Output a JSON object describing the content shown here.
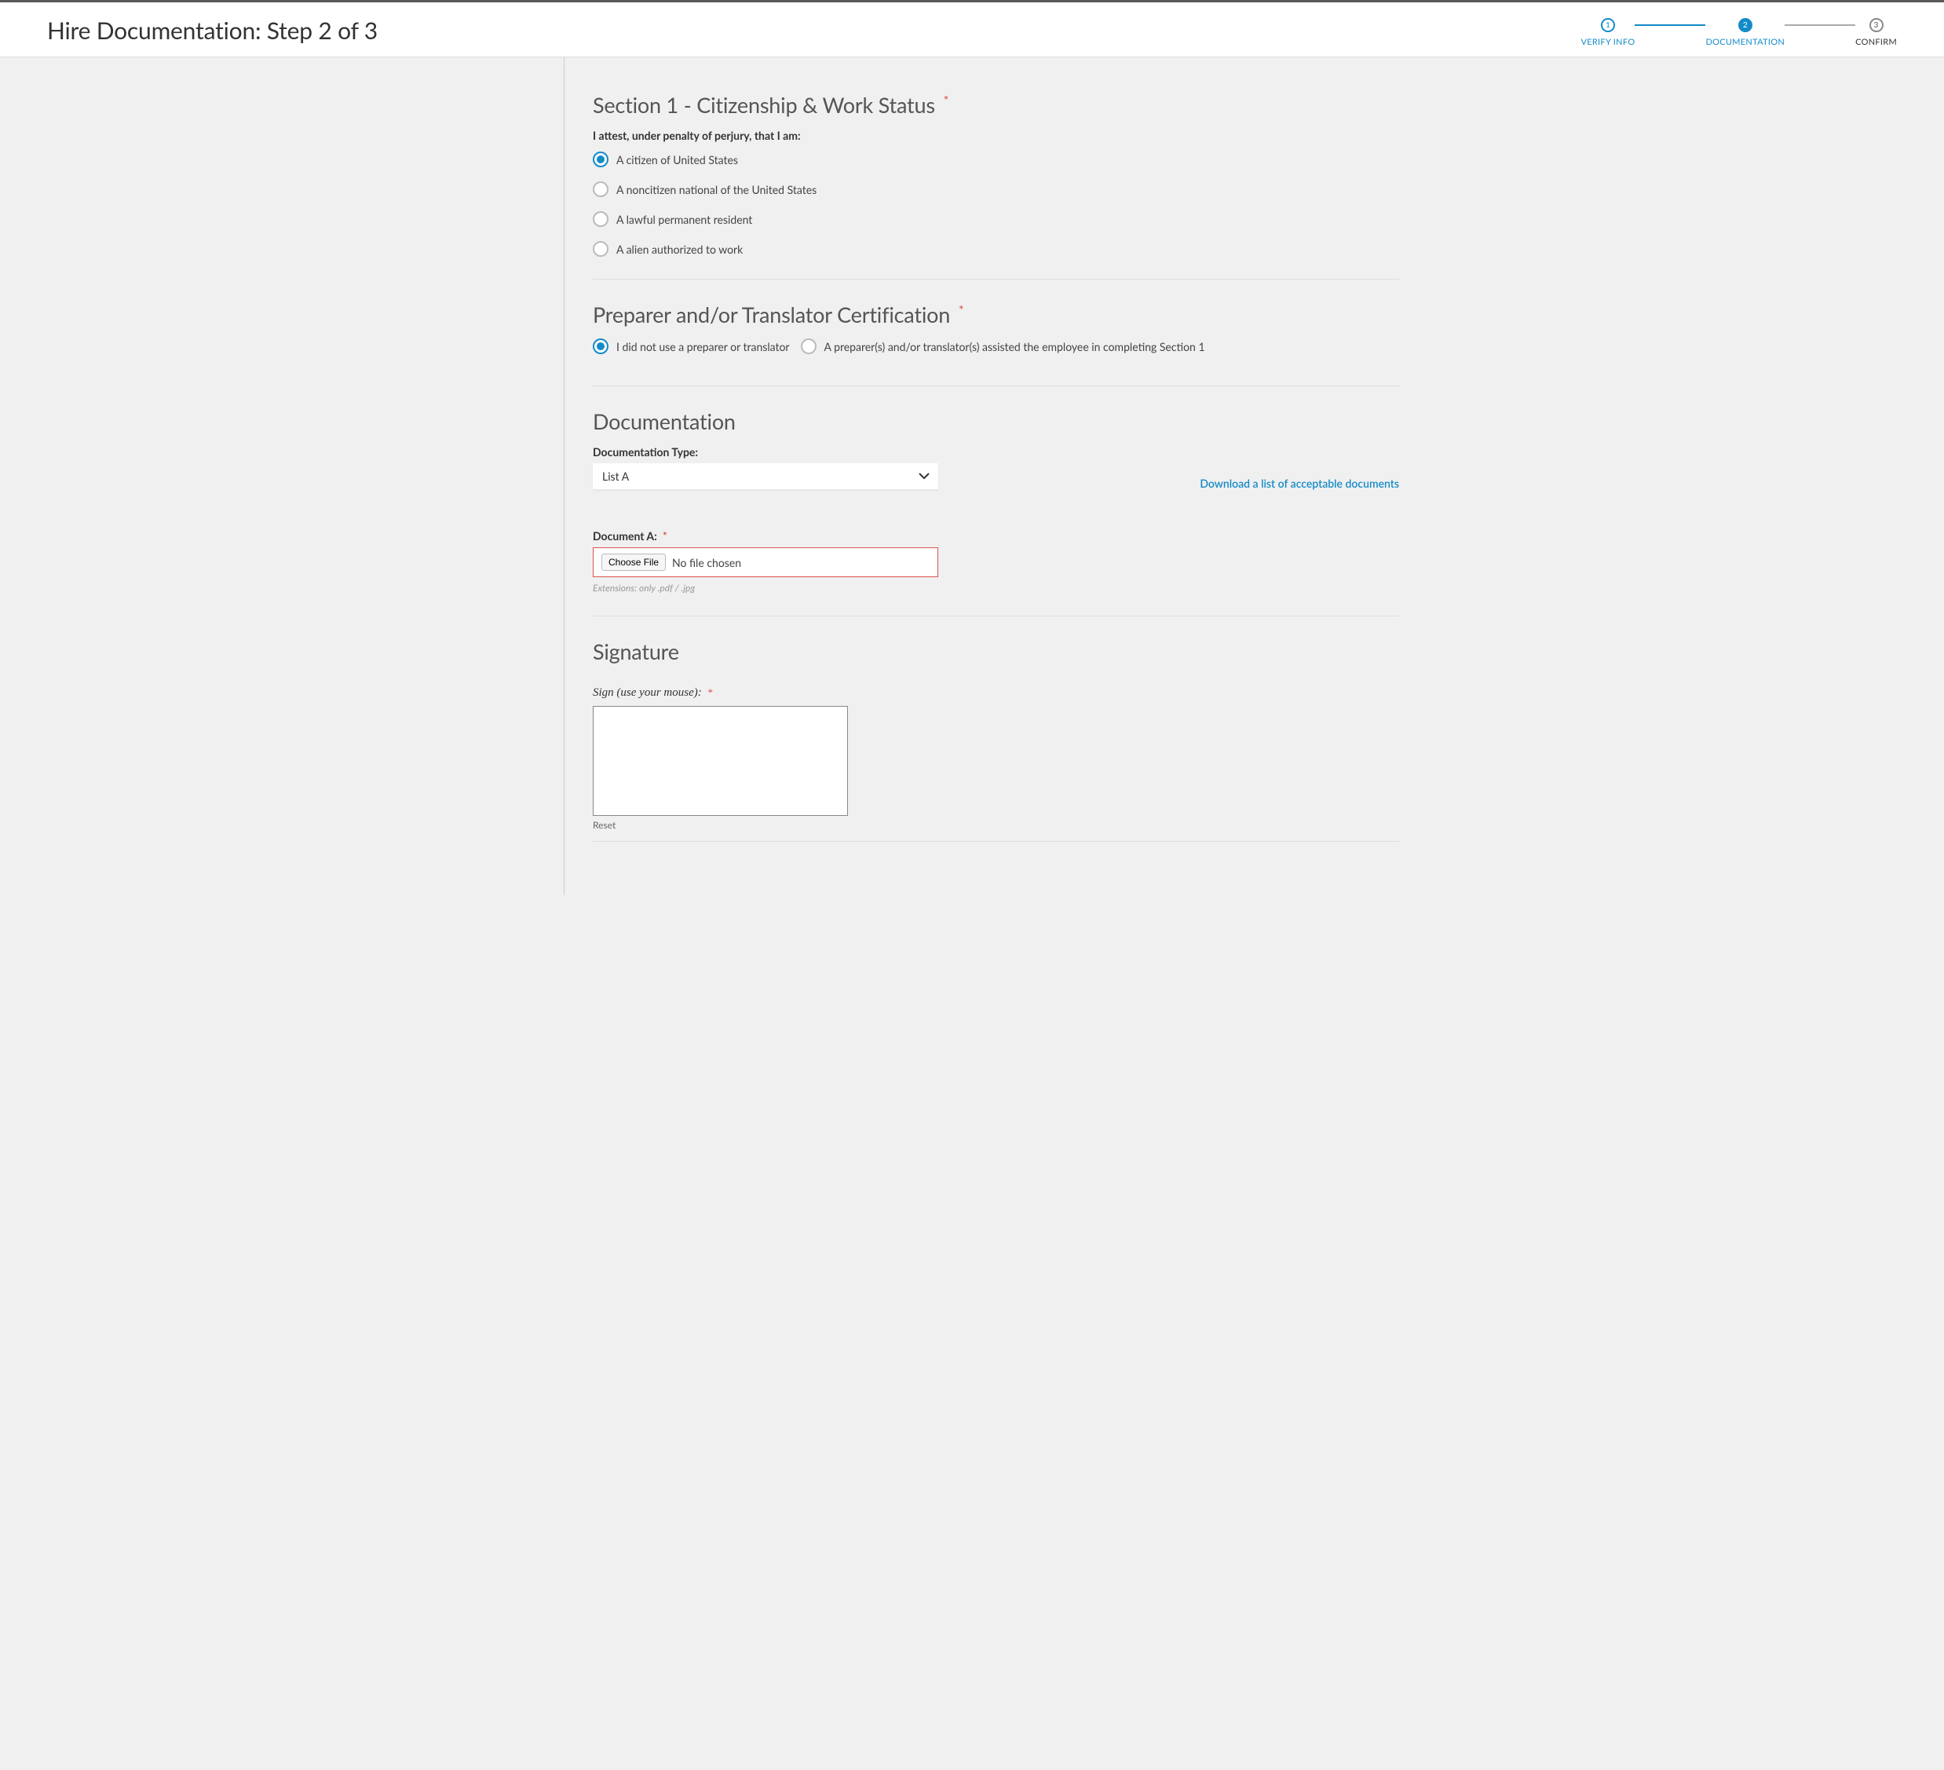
{
  "header": {
    "title": "Hire Documentation: Step 2 of 3"
  },
  "stepper": {
    "steps": [
      {
        "num": "1",
        "label": "VERIFY INFO"
      },
      {
        "num": "2",
        "label": "DOCUMENTATION"
      },
      {
        "num": "3",
        "label": "CONFIRM"
      }
    ]
  },
  "section1": {
    "title": "Section 1 - Citizenship & Work Status",
    "attest": "I attest, under penalty of perjury, that I am:",
    "options": [
      "A citizen of United States",
      "A noncitizen national of the United States",
      "A lawful permanent resident",
      "A alien authorized to work"
    ]
  },
  "preparer": {
    "title": "Preparer and/or Translator Certification",
    "options": [
      "I did not use a preparer or translator",
      "A preparer(s) and/or translator(s) assisted the employee in completing Section 1"
    ]
  },
  "documentation": {
    "title": "Documentation",
    "type_label": "Documentation Type:",
    "type_value": "List A",
    "download_link": "Download a list of acceptable documents",
    "docA_label": "Document A:",
    "choose_label": "Choose File",
    "file_status": "No file chosen",
    "extensions_hint": "Extensions: only .pdf / .jpg"
  },
  "signature": {
    "title": "Signature",
    "sign_label": "Sign (use your mouse):",
    "reset": "Reset"
  }
}
